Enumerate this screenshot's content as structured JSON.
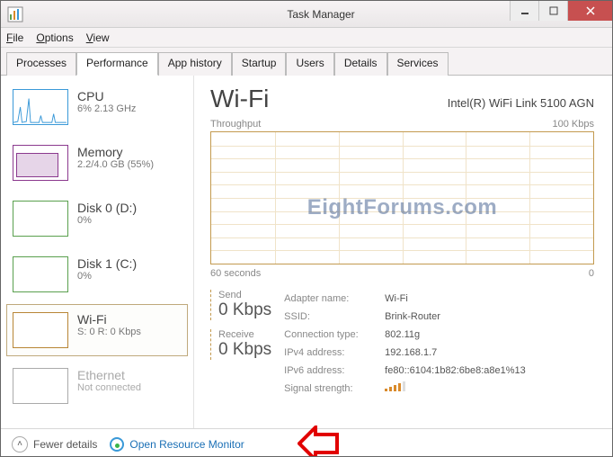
{
  "window": {
    "title": "Task Manager"
  },
  "menus": {
    "file": "File",
    "options": "Options",
    "view": "View"
  },
  "tabs": [
    "Processes",
    "Performance",
    "App history",
    "Startup",
    "Users",
    "Details",
    "Services"
  ],
  "active_tab": 1,
  "sidebar": {
    "items": [
      {
        "title": "CPU",
        "sub": "6% 2.13 GHz"
      },
      {
        "title": "Memory",
        "sub": "2.2/4.0 GB (55%)"
      },
      {
        "title": "Disk 0 (D:)",
        "sub": "0%"
      },
      {
        "title": "Disk 1 (C:)",
        "sub": "0%"
      },
      {
        "title": "Wi-Fi",
        "sub": "S: 0 R: 0 Kbps"
      },
      {
        "title": "Ethernet",
        "sub": "Not connected"
      }
    ]
  },
  "detail": {
    "heading": "Wi-Fi",
    "adapter": "Intel(R) WiFi Link 5100 AGN",
    "chart_label_left": "Throughput",
    "chart_label_right": "100 Kbps",
    "chart_bot_left": "60 seconds",
    "chart_bot_right": "0",
    "watermark": "EightForums.com",
    "send_label": "Send",
    "send_value": "0 Kbps",
    "recv_label": "Receive",
    "recv_value": "0 Kbps",
    "rows": {
      "adapter_name_k": "Adapter name:",
      "adapter_name_v": "Wi-Fi",
      "ssid_k": "SSID:",
      "ssid_v": "Brink-Router",
      "ctype_k": "Connection type:",
      "ctype_v": "802.11g",
      "ipv4_k": "IPv4 address:",
      "ipv4_v": "192.168.1.7",
      "ipv6_k": "IPv6 address:",
      "ipv6_v": "fe80::6104:1b82:6be8:a8e1%13",
      "signal_k": "Signal strength:"
    }
  },
  "footer": {
    "fewer": "Fewer details",
    "resmon": "Open Resource Monitor"
  },
  "chart_data": {
    "type": "line",
    "title": "Throughput",
    "ylabel": "Kbps",
    "ylim": [
      0,
      100
    ],
    "xrange_seconds": 60,
    "series": [
      {
        "name": "Send",
        "values_kbps_constant": 0
      },
      {
        "name": "Receive",
        "values_kbps_constant": 0
      }
    ]
  }
}
